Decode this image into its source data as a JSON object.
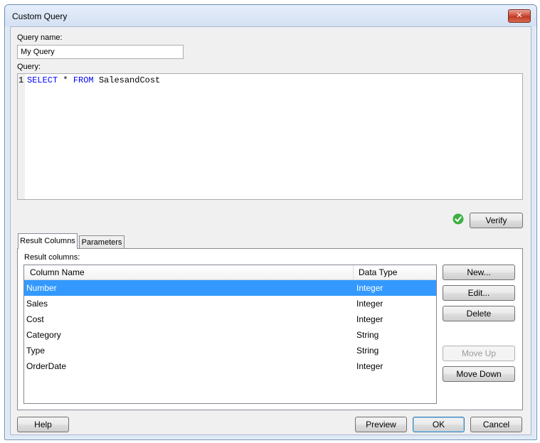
{
  "window": {
    "title": "Custom Query",
    "close_label": "✕"
  },
  "query_name": {
    "label": "Query name:",
    "value": "My Query"
  },
  "query": {
    "label": "Query:",
    "line_number": "1",
    "tokens": [
      "SELECT",
      " * ",
      "FROM",
      " SalesandCost"
    ]
  },
  "verify": {
    "label": "Verify",
    "status_color": "#3cb043"
  },
  "tabs": [
    {
      "label": "Result Columns",
      "active": true
    },
    {
      "label": "Parameters",
      "active": false
    }
  ],
  "result_columns": {
    "label": "Result columns:",
    "headers": [
      "Column Name",
      "Data Type"
    ],
    "rows": [
      {
        "name": "Number",
        "type": "Integer",
        "selected": true
      },
      {
        "name": "Sales",
        "type": "Integer"
      },
      {
        "name": "Cost",
        "type": "Integer"
      },
      {
        "name": "Category",
        "type": "String"
      },
      {
        "name": "Type",
        "type": "String"
      },
      {
        "name": "OrderDate",
        "type": "Integer"
      }
    ]
  },
  "side_buttons": {
    "new": "New...",
    "edit": "Edit...",
    "delete": "Delete",
    "move_up": "Move Up",
    "move_down": "Move Down"
  },
  "footer": {
    "help": "Help",
    "preview": "Preview",
    "ok": "OK",
    "cancel": "Cancel"
  },
  "colors": {
    "selection": "#3399ff",
    "keyword": "#0000ff",
    "close": "#c03a22"
  }
}
